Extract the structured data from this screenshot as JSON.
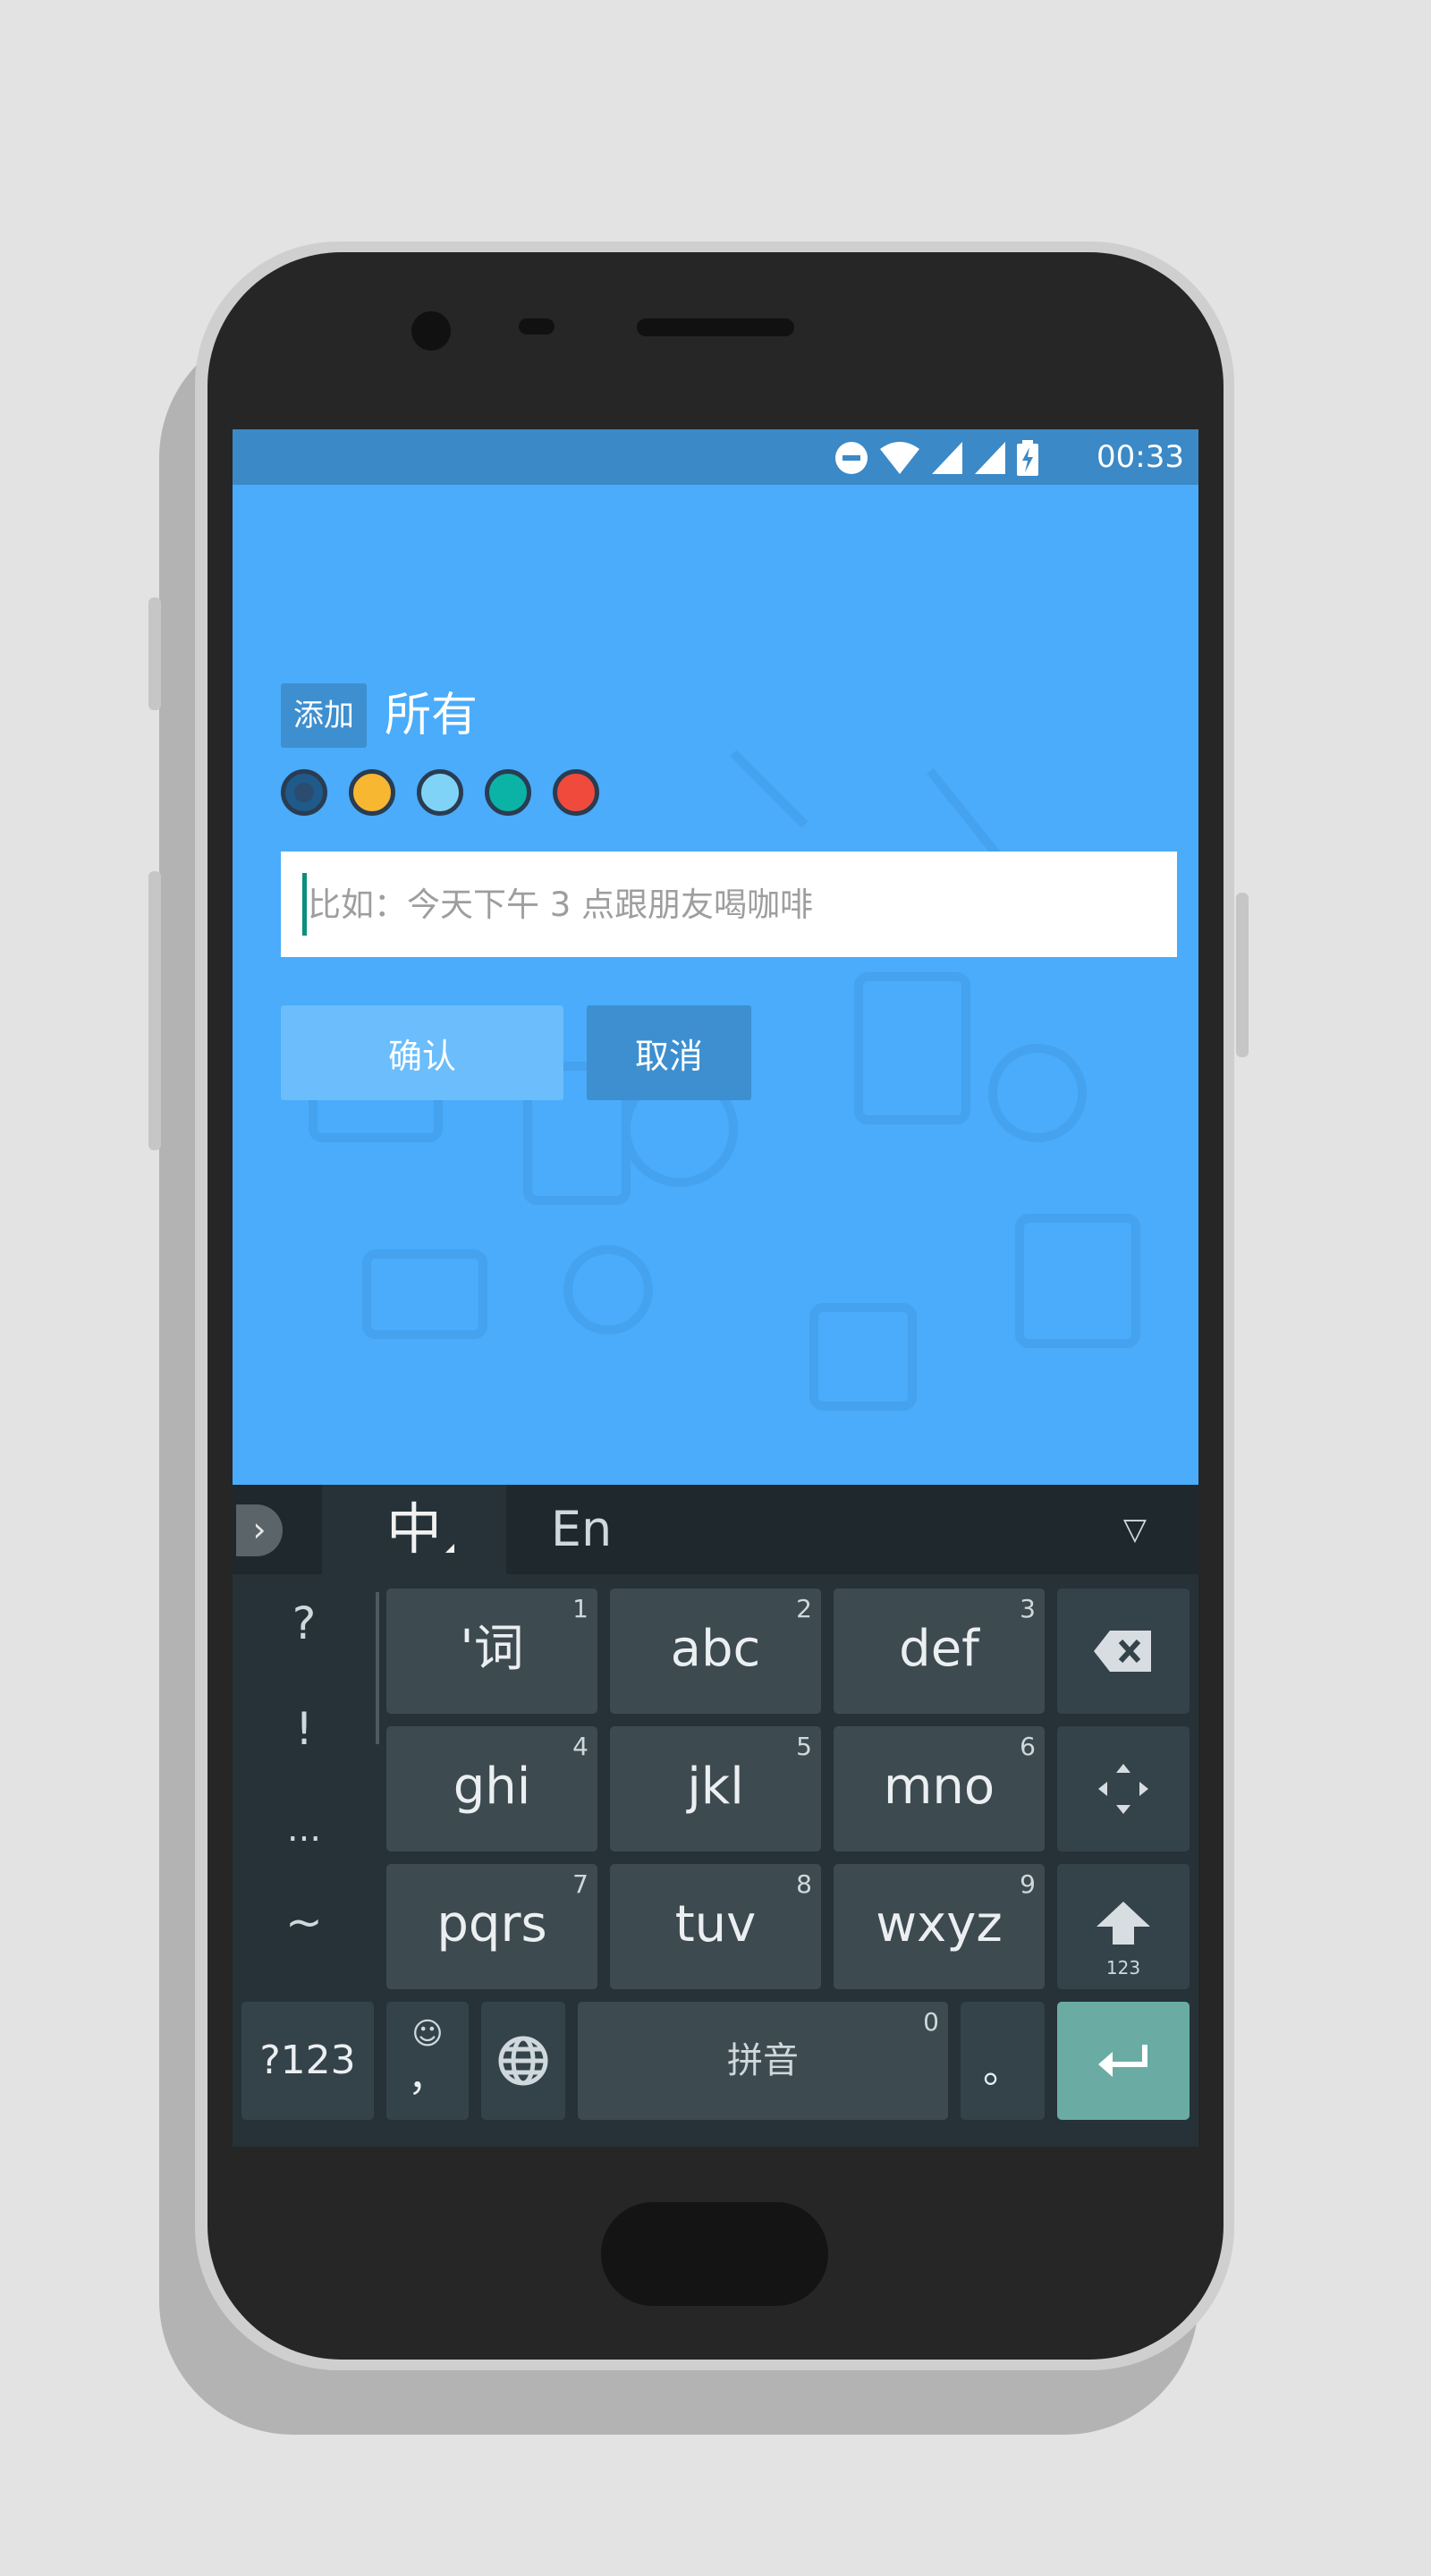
{
  "status_bar": {
    "time": "00:33",
    "icons": [
      "do-not-disturb-icon",
      "wifi-icon",
      "signal-icon",
      "signal-icon",
      "battery-charging-icon"
    ]
  },
  "app": {
    "tag_label": "添加",
    "list_title": "所有",
    "colors": [
      "#1f5a8a",
      "#f7b731",
      "#7fd3f7",
      "#0ab3a6",
      "#f04a3c"
    ],
    "selected_color_index": 0,
    "input": {
      "value": "",
      "placeholder": "比如：今天下午 3 点跟朋友喝咖啡"
    },
    "confirm_label": "确认",
    "cancel_label": "取消"
  },
  "keyboard": {
    "tabs": {
      "zh": "中",
      "en": "En"
    },
    "punctuation": [
      "?",
      "!",
      "...",
      "~"
    ],
    "rows": [
      [
        {
          "label": "'词",
          "num": "1"
        },
        {
          "label": "abc",
          "num": "2"
        },
        {
          "label": "def",
          "num": "3"
        }
      ],
      [
        {
          "label": "ghi",
          "num": "4"
        },
        {
          "label": "jkl",
          "num": "5"
        },
        {
          "label": "mno",
          "num": "6"
        }
      ],
      [
        {
          "label": "pqrs",
          "num": "7"
        },
        {
          "label": "tuv",
          "num": "8"
        },
        {
          "label": "wxyz",
          "num": "9"
        }
      ]
    ],
    "shift_sub": "123",
    "bottom": {
      "numbers_label": "?123",
      "emoji_label": "☺",
      "comma_label": "，",
      "space_label": "拼音",
      "space_num": "0",
      "period_label": "。"
    }
  }
}
